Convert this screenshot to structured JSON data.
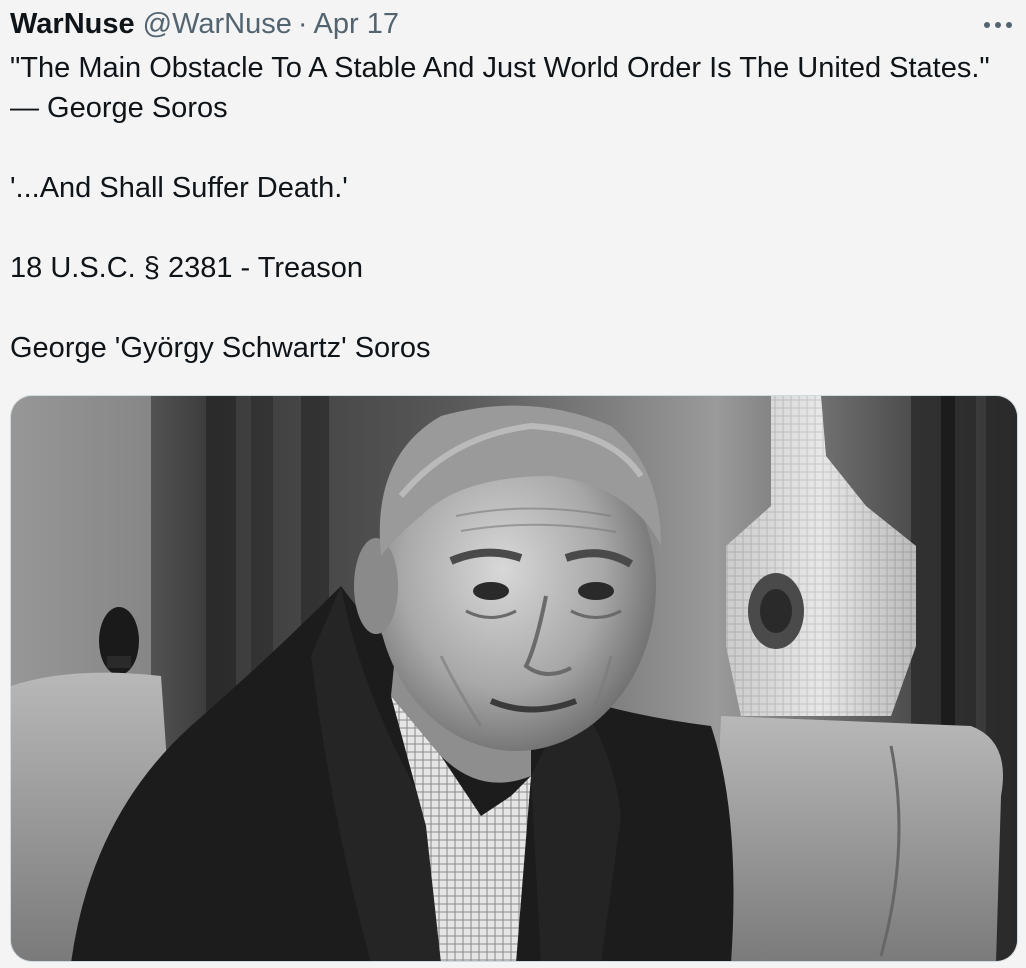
{
  "post": {
    "author": {
      "display_name": "WarNuse",
      "handle": "@WarNuse"
    },
    "separator": "·",
    "timestamp": "Apr 17",
    "more_icon": "more-horizontal-icon",
    "text": {
      "paragraph_1": "\"The Main Obstacle To A Stable And Just World Order Is The United States.\" — George Soros",
      "paragraph_2": "'...And Shall Suffer Death.'",
      "paragraph_3": "18 U.S.C. § 2381 - Treason",
      "paragraph_4": "George 'György Schwartz' Soros"
    }
  },
  "colors": {
    "background": "#f4f4f4",
    "text_primary": "#0f1419",
    "text_secondary": "#536471"
  }
}
